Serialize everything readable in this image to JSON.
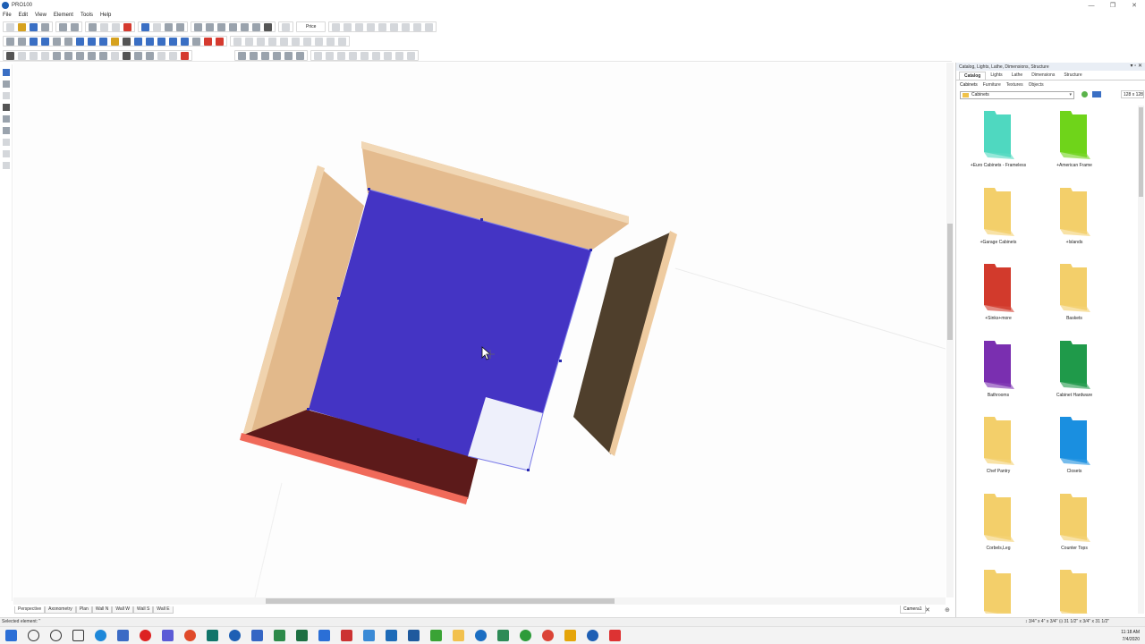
{
  "window": {
    "title": "PRO100",
    "controls": [
      "—",
      "❐",
      "✕"
    ]
  },
  "menu": [
    "File",
    "Edit",
    "View",
    "Element",
    "Tools",
    "Help"
  ],
  "toolbar": {
    "price_label": "Price"
  },
  "viewport": {
    "cursor_icon": "move-cursor-icon"
  },
  "view_tabs": [
    "Perspective",
    "Axonometry",
    "Plan",
    "Wall N",
    "Wall W",
    "Wall S",
    "Wall E"
  ],
  "camera_tab": "Camera1",
  "status": {
    "text": "Selected element: ''",
    "dims": "↕ 3/4\" x 4\" x 3/4\"  ⊡ 31 1/2\" x 3/4\" x 31 1/2\""
  },
  "panel": {
    "title": "Catalog, Lights, Lathe, Dimensions, Structure",
    "tabs": [
      "Catalog",
      "Lights",
      "Lathe",
      "Dimensions",
      "Structure"
    ],
    "sub_tabs": [
      "Cabinets",
      "Furniture",
      "Textures",
      "Objects"
    ],
    "folder": "Cabinets",
    "thumb_size": "128 x 128",
    "items": [
      {
        "label": "+Euro Cabinets - Frameless",
        "color": "#4fd8c0"
      },
      {
        "label": "+American Frame",
        "color": "#6fd41a"
      },
      {
        "label": "+Garage Cabinets",
        "color": "#f3cf6a"
      },
      {
        "label": "+Islands",
        "color": "#f3cf6a"
      },
      {
        "label": "+Sinks+more",
        "color": "#d23a2c"
      },
      {
        "label": "Baskets",
        "color": "#f3cf6a"
      },
      {
        "label": "Bathrooms",
        "color": "#7a2fb0"
      },
      {
        "label": "Cabinet Hardware",
        "color": "#1f9a4a"
      },
      {
        "label": "Chef Pantry",
        "color": "#f3cf6a"
      },
      {
        "label": "Closets",
        "color": "#1a8fe0"
      },
      {
        "label": "Corbels,Leg",
        "color": "#f3cf6a"
      },
      {
        "label": "Counter Tops",
        "color": "#f3cf6a"
      },
      {
        "label": "",
        "color": "#f3cf6a"
      },
      {
        "label": "",
        "color": "#f3cf6a"
      }
    ]
  },
  "clock": {
    "time": "11:18 AM",
    "date": "7/4/2020"
  }
}
